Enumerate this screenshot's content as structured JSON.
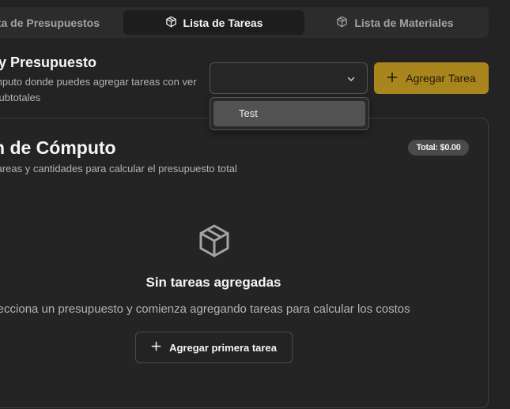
{
  "tabs": [
    {
      "label": "sta de Presupuestos",
      "icon": "",
      "active": false
    },
    {
      "label": "Lista de Tareas",
      "icon": "package-icon",
      "active": true
    },
    {
      "label": "Lista de Materiales",
      "icon": "package-icon",
      "active": false
    }
  ],
  "header": {
    "title": "y Presupuesto",
    "description": "mputo donde puedes agregar tareas con ver subtotales"
  },
  "select": {
    "value": "",
    "icon": "chevron-down-icon"
  },
  "dropdown": {
    "options": [
      "Test"
    ]
  },
  "add_task_button": {
    "label": "Agregar Tarea",
    "icon": "plus-icon"
  },
  "card": {
    "title": "n de Cómputo",
    "subtitle": "tareas y cantidades para calcular el presupuesto total",
    "total_badge": "Total: $0.00",
    "empty_state": {
      "icon": "package-icon",
      "title": "Sin tareas agregadas",
      "description": "elecciona un presupuesto y comienza agregando tareas para calcular los costos",
      "button_label": "Agregar primera tarea",
      "button_icon": "plus-icon"
    }
  },
  "colors": {
    "background": "#232323",
    "accent": "#a8861d",
    "card_border": "#3e3e3e",
    "muted_text": "#b3b3b3"
  }
}
